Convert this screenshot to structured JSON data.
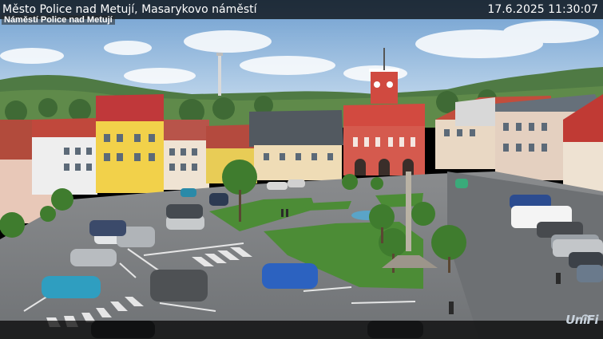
{
  "overlay": {
    "title": "Město Police nad Metují, Masarykovo náměstí",
    "subtitle": "Náměstí Police nad Metují",
    "datetime": "17.6.2025 11:30:07"
  },
  "logo": {
    "text": "UniFi"
  },
  "colors": {
    "sky": "#aac8e6",
    "hills": "#4f7a44",
    "square_asphalt": "#7d8083",
    "grass": "#4c8c36",
    "town_hall": "#d04a40",
    "overlay_bar": "#000000"
  }
}
